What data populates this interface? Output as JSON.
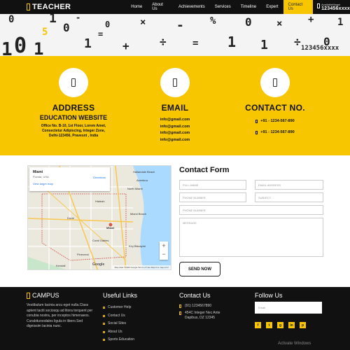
{
  "brand": {
    "name": "TEACHER"
  },
  "nav": {
    "items": [
      "Home",
      "About Us",
      "Achievements",
      "Services",
      "Timeline",
      "Expert",
      "Contact Us"
    ],
    "active_index": 6,
    "call_label": "AvailableMagni",
    "call_number": "123456xxxx"
  },
  "hero": {
    "decor": [
      "1",
      "0",
      "1",
      "0",
      "1",
      "0",
      "1",
      "0",
      "+",
      "×",
      "÷",
      "-",
      "=",
      "%",
      "1",
      "0",
      "1",
      "×",
      "÷",
      "+",
      "0",
      "1",
      "-",
      "=",
      "5"
    ],
    "numbers": "123456xxxx"
  },
  "info": {
    "address": {
      "title": "ADDRESS",
      "subtitle": "EDUCATION WEBSITE",
      "lines": [
        "Office No. B-10, 1st Floor, Lorem Amet,",
        "Consectetur Adipiscing, Integer Zone,",
        "Delhi-123456, Pravesnt , India"
      ]
    },
    "email": {
      "title": "EMAIL",
      "emails": [
        "info@gmail.com",
        "info@gmail.com",
        "info@gmail.com",
        "info@gmail.com"
      ]
    },
    "contact": {
      "title": "CONTACT NO.",
      "phones": [
        "+91 - 1234-567-890",
        "+91 - 1234-567-890"
      ]
    }
  },
  "map": {
    "place": "Miami",
    "region": "Florida, USA",
    "larger_link": "View larger map",
    "directions": "Directions",
    "labels": [
      "Hialeah",
      "Miami Beach",
      "Miami",
      "Doral",
      "Kendall",
      "Pinecrest",
      "Coral Gables",
      "Key Biscayne",
      "North Miami",
      "Aventura",
      "Hallandale Beach"
    ],
    "footer": "Map data ©2020 Google   Terms of Use   Report a map error",
    "google": "Google",
    "zoom_in": "+",
    "zoom_out": "−"
  },
  "form": {
    "title": "Contact Form",
    "full_name": "FULL NAME",
    "email": "EMAIL ADDRESS",
    "phone": "PHONE NUMBER",
    "subject": "SUBJECT",
    "phone2": "PHONE NUMBER",
    "message": "MESSAGE",
    "send": "SEND NOW"
  },
  "footer": {
    "campus_title": "CAMPUS",
    "about": "Vestibulum lacinia arcu eget nulla.Class aptent taciti sociosqu ad litora torquent per conubia nostra, per inceptos himenaeos. Curabitursodales ligula in libero.Sed dignissim lacinia nunc.",
    "links_title": "Useful Links",
    "links": [
      "Customer Help",
      "Contact Us",
      "Social Sites",
      "About Us",
      "Sports Education"
    ],
    "contact_title": "Contact Us",
    "contact_phone": "(91) 1234567890",
    "contact_address": "454C Integer Nec Ante Dapibus, DZ 12345",
    "follow_title": "Follow Us",
    "email_placeholder": "Email",
    "socials": [
      "f",
      "t",
      "g",
      "in",
      "p"
    ],
    "watermark": "Activate Windows"
  }
}
